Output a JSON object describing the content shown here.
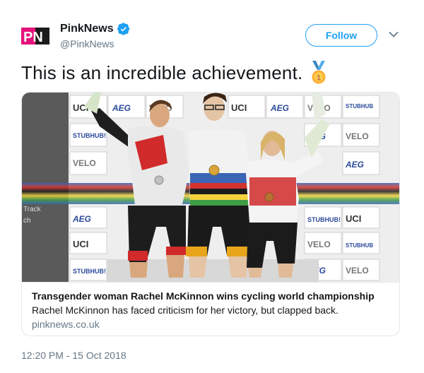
{
  "user": {
    "logo_text": "PN",
    "display_name": "PinkNews",
    "handle": "@PinkNews",
    "verified": true
  },
  "actions": {
    "follow_label": "Follow",
    "menu_icon": "chevron-down-icon"
  },
  "tweet": {
    "text": "This is an incredible achievement.",
    "emoji": "medal-icon",
    "timestamp": "12:20 PM - 15 Oct 2018"
  },
  "card": {
    "image_description": "photo",
    "title": "Transgender woman Rachel McKinnon wins cycling world championship",
    "description": "Rachel McKinnon has faced criticism for her victory, but clapped back.",
    "domain": "pinknews.co.uk",
    "sign_texts": [
      "UCI",
      "AEG",
      "VELO",
      "STUBHUB!",
      "Track",
      "ch"
    ]
  },
  "colors": {
    "brand_pink": "#e4127a",
    "link_blue": "#1da1f2",
    "muted_gray": "#657786"
  }
}
